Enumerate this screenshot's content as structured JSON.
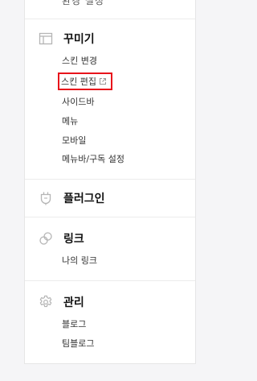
{
  "top_clipped": "환경 설정",
  "sections": {
    "decorate": {
      "title": "꾸미기",
      "icon": "layout-icon",
      "items": [
        "스킨 변경",
        "스킨 편집",
        "사이드바",
        "메뉴",
        "모바일",
        "메뉴바/구독 설정"
      ]
    },
    "plugin": {
      "title": "플러그인",
      "icon": "plug-icon"
    },
    "link": {
      "title": "링크",
      "icon": "link-icon",
      "items": [
        "나의 링크"
      ]
    },
    "manage": {
      "title": "관리",
      "icon": "gear-icon",
      "items": [
        "블로그",
        "팀블로그"
      ]
    }
  },
  "colors": {
    "highlight": "#e8141b",
    "icon": "#b5b5b5",
    "divider": "#ececec"
  }
}
